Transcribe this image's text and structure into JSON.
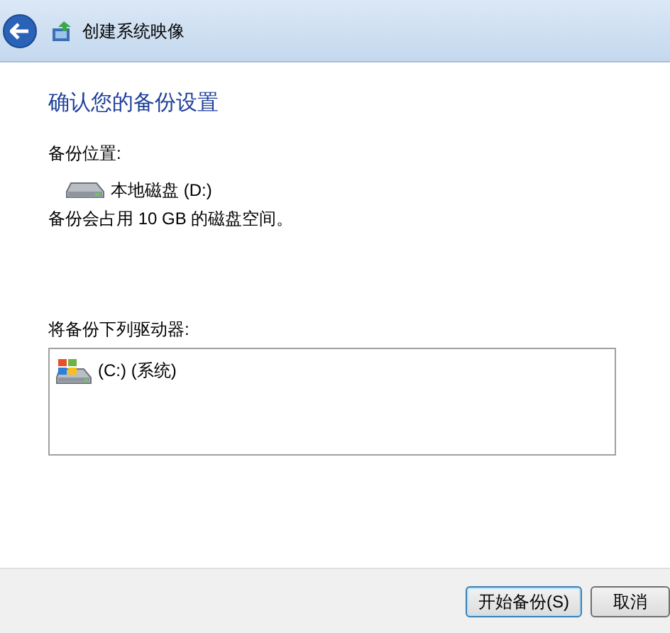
{
  "window": {
    "title": "创建系统映像"
  },
  "heading": "确认您的备份设置",
  "backup_location": {
    "label": "备份位置:",
    "drive": "本地磁盘 (D:)",
    "usage": "备份会占用 10 GB 的磁盘空间。"
  },
  "drives": {
    "label": "将备份下列驱动器:",
    "items": [
      {
        "name": "(C:) (系统)"
      }
    ]
  },
  "buttons": [
    {
      "label": "开始备份(S)",
      "default": true
    },
    {
      "label": "取消",
      "default": false
    }
  ]
}
